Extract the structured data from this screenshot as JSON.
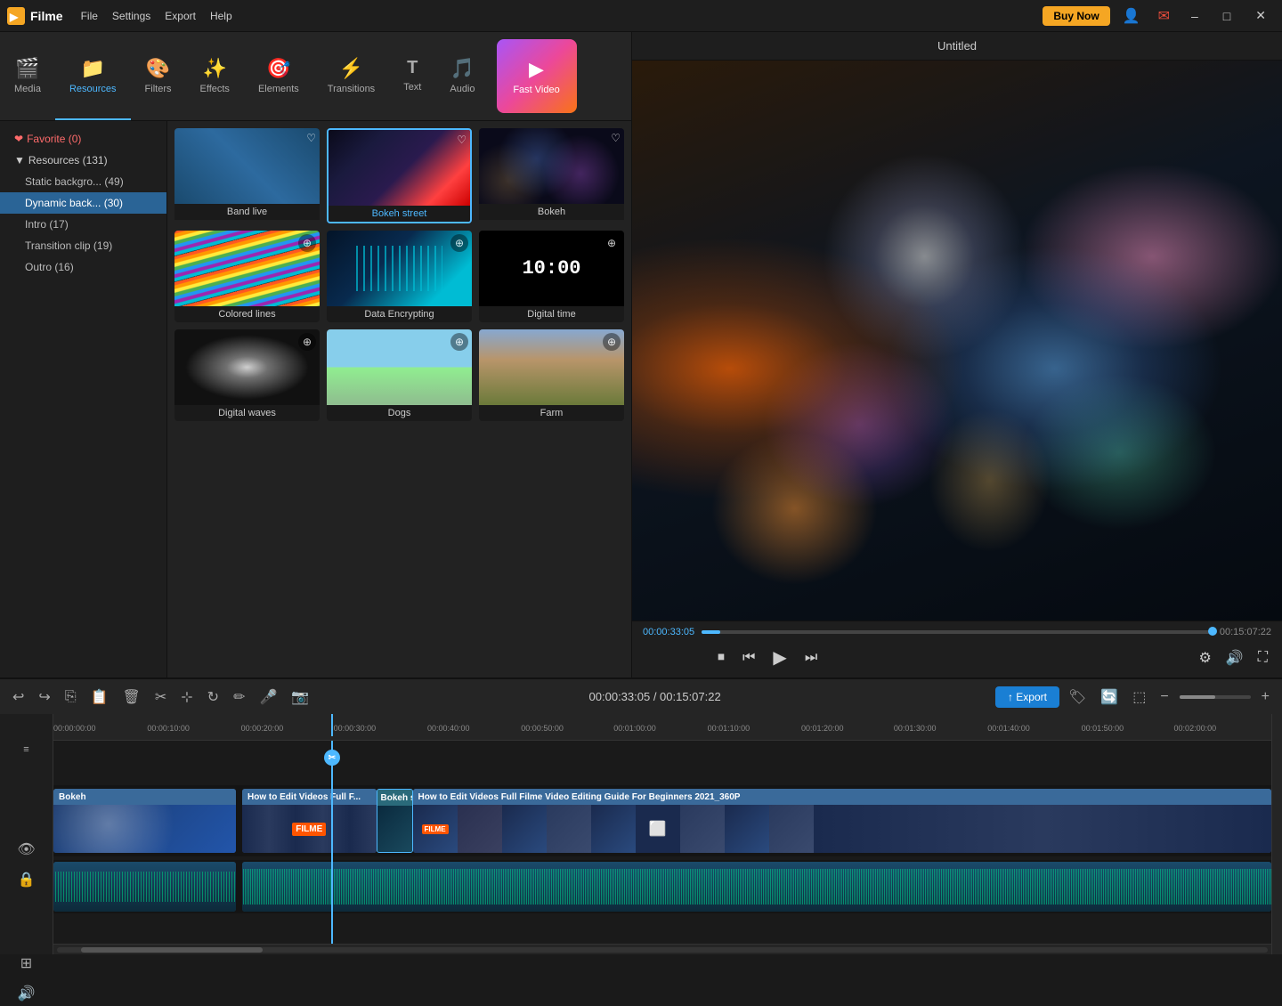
{
  "app": {
    "name": "Filme",
    "title": "Untitled"
  },
  "titlebar": {
    "menu": [
      "File",
      "Settings",
      "Export",
      "Help"
    ],
    "buy_now": "Buy Now",
    "minimize": "–",
    "maximize": "□",
    "close": "✕"
  },
  "navbar": {
    "items": [
      {
        "id": "media",
        "label": "Media",
        "icon": "🎬"
      },
      {
        "id": "resources",
        "label": "Resources",
        "icon": "📁"
      },
      {
        "id": "filters",
        "label": "Filters",
        "icon": "🎨"
      },
      {
        "id": "effects",
        "label": "Effects",
        "icon": "✨"
      },
      {
        "id": "elements",
        "label": "Elements",
        "icon": "🎯"
      },
      {
        "id": "transitions",
        "label": "Transitions",
        "icon": "⚡"
      },
      {
        "id": "text",
        "label": "Text",
        "icon": "T"
      },
      {
        "id": "audio",
        "label": "Audio",
        "icon": "🎵"
      },
      {
        "id": "fast_video",
        "label": "Fast Video",
        "icon": "▶"
      }
    ]
  },
  "sidebar": {
    "items": [
      {
        "id": "favorite",
        "label": "Favorite (0)",
        "type": "favorite"
      },
      {
        "id": "resources",
        "label": "Resources (131)",
        "type": "parent"
      },
      {
        "id": "static_bg",
        "label": "Static backgro... (49)",
        "type": "child"
      },
      {
        "id": "dynamic_bg",
        "label": "Dynamic back... (30)",
        "type": "child",
        "active": true
      },
      {
        "id": "intro",
        "label": "Intro (17)",
        "type": "child"
      },
      {
        "id": "transition_clip",
        "label": "Transition clip (19)",
        "type": "child"
      },
      {
        "id": "outro",
        "label": "Outro (16)",
        "type": "child"
      }
    ]
  },
  "grid": {
    "items": [
      {
        "id": "band_live",
        "label": "Band live",
        "type": "heart",
        "thumb_class": "thumb-band-live"
      },
      {
        "id": "bokeh_street",
        "label": "Bokeh street",
        "type": "heart",
        "selected": true,
        "thumb_class": "thumb-bokeh-street"
      },
      {
        "id": "bokeh",
        "label": "Bokeh",
        "type": "heart",
        "thumb_class": "thumb-bokeh"
      },
      {
        "id": "colored_lines",
        "label": "Colored lines",
        "type": "download",
        "thumb_class": "thumb-colored-lines wavy-lines"
      },
      {
        "id": "data_encrypting",
        "label": "Data Encrypting",
        "type": "download",
        "thumb_class": "thumb-data-encrypting"
      },
      {
        "id": "digital_time",
        "label": "Digital time",
        "type": "download",
        "thumb_class": "thumb-digital-time",
        "time_text": "10:00"
      },
      {
        "id": "digital_waves",
        "label": "Digital waves",
        "type": "download",
        "thumb_class": "thumb-digital-waves"
      },
      {
        "id": "dogs",
        "label": "Dogs",
        "type": "download",
        "thumb_class": "thumb-dogs"
      },
      {
        "id": "farm",
        "label": "Farm",
        "type": "download",
        "thumb_class": "thumb-farm"
      }
    ]
  },
  "preview": {
    "title": "Untitled",
    "time_current": "00:00:33:05",
    "time_total": "00:15:07:22",
    "progress_pct": "3.7"
  },
  "toolbar": {
    "time_display": "00:00:33:05 / 00:15:07:22",
    "export_label": "↑ Export"
  },
  "timeline": {
    "playhead_time": "00:00:33:05",
    "ruler_marks": [
      "00:00:00:00",
      "00:00:10:00",
      "00:00:20:00",
      "00:00:30:00",
      "00:00:40:00",
      "00:00:50:00",
      "00:01:00:00",
      "00:01:10:00",
      "00:01:20:00",
      "00:01:30:00",
      "00:01:40:00",
      "00:01:50:00",
      "00:02:00:00"
    ],
    "clips": [
      {
        "id": "bokeh_clip",
        "label": "Bokeh",
        "track": 0,
        "start_pct": 0,
        "width_pct": 15,
        "type": "blue"
      },
      {
        "id": "how_to_edit_1",
        "label": "How to Edit Videos Full F...",
        "track": 0,
        "start_pct": 16.5,
        "width_pct": 11,
        "type": "blue"
      },
      {
        "id": "bokeh_s",
        "label": "Bokeh s...",
        "track": 0,
        "start_pct": 27.5,
        "width_pct": 3,
        "type": "cyan"
      },
      {
        "id": "how_to_edit_2",
        "label": "How to Edit Videos Full Filme Video Editing Guide For Beginners 2021_360P",
        "track": 0,
        "start_pct": 30.5,
        "width_pct": 69.5,
        "type": "blue"
      }
    ]
  }
}
